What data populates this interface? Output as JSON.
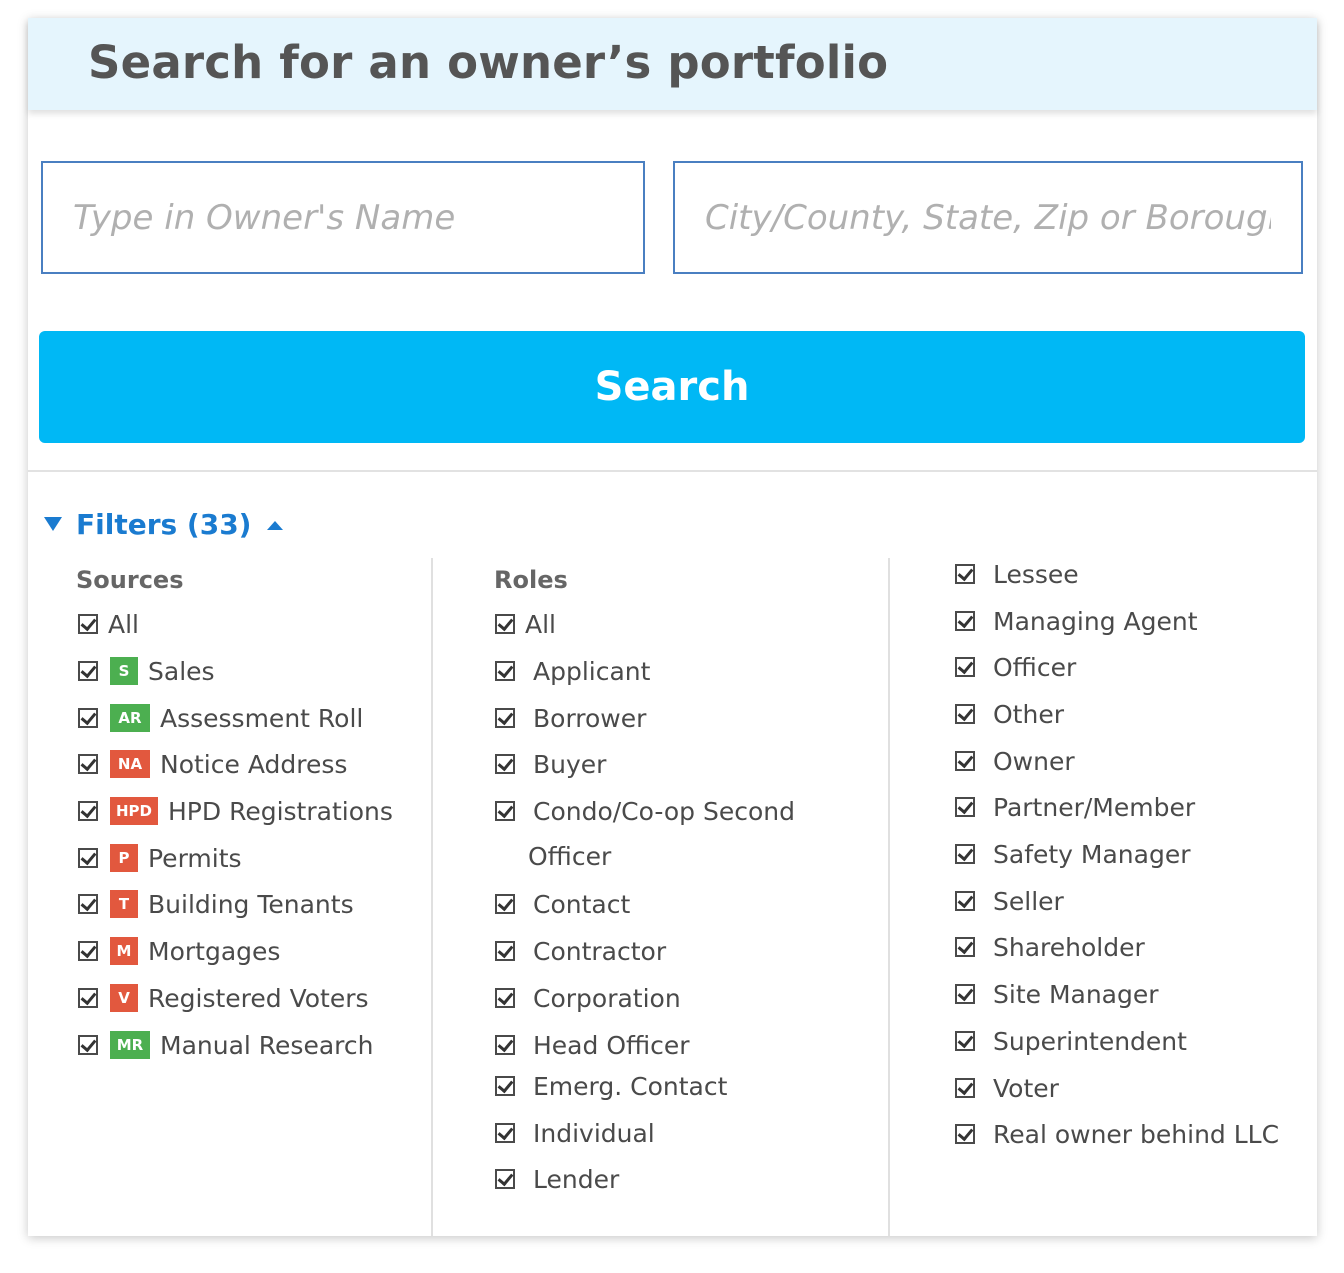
{
  "header": {
    "title": "Search for an owner’s portfolio"
  },
  "search": {
    "owner_placeholder": "Type in Owner's Name",
    "location_placeholder": "City/County, State, Zip or Borough",
    "button_label": "Search"
  },
  "filters": {
    "label": "Filters (33)"
  },
  "sources": {
    "heading": "Sources",
    "all_label": "All",
    "items": [
      {
        "badge": "S",
        "label": "Sales",
        "color": "#4caf50"
      },
      {
        "badge": "AR",
        "label": "Assessment Roll",
        "color": "#4caf50"
      },
      {
        "badge": "NA",
        "label": "Notice Address",
        "color": "#e2583e"
      },
      {
        "badge": "HPD",
        "label": "HPD Registrations",
        "color": "#e2583e"
      },
      {
        "badge": "P",
        "label": "Permits",
        "color": "#e2583e"
      },
      {
        "badge": "T",
        "label": "Building Tenants",
        "color": "#e2583e"
      },
      {
        "badge": "M",
        "label": "Mortgages",
        "color": "#e2583e"
      },
      {
        "badge": "V",
        "label": "Registered Voters",
        "color": "#e2583e"
      },
      {
        "badge": "MR",
        "label": "Manual Research",
        "color": "#4caf50"
      }
    ]
  },
  "roles": {
    "heading": "Roles",
    "all_label": "All",
    "items": [
      "Applicant",
      "Borrower",
      "Buyer",
      "Condo/Co-op Second",
      "Officer",
      "Contact",
      "Contractor",
      "Corporation",
      "Head Officer",
      "Emerg. Contact",
      "Individual",
      "Lender"
    ],
    "items_col3": [
      "Lessee",
      "Managing Agent",
      "Officer",
      "Other",
      "Owner",
      "Partner/Member",
      "Safety Manager",
      "Seller",
      "Shareholder",
      "Site Manager",
      "Superintendent",
      "Voter",
      "Real owner behind LLC"
    ]
  },
  "colors": {
    "accent": "#00b8f5",
    "link": "#1a7bd0",
    "header_bg": "#e5f5fd"
  }
}
